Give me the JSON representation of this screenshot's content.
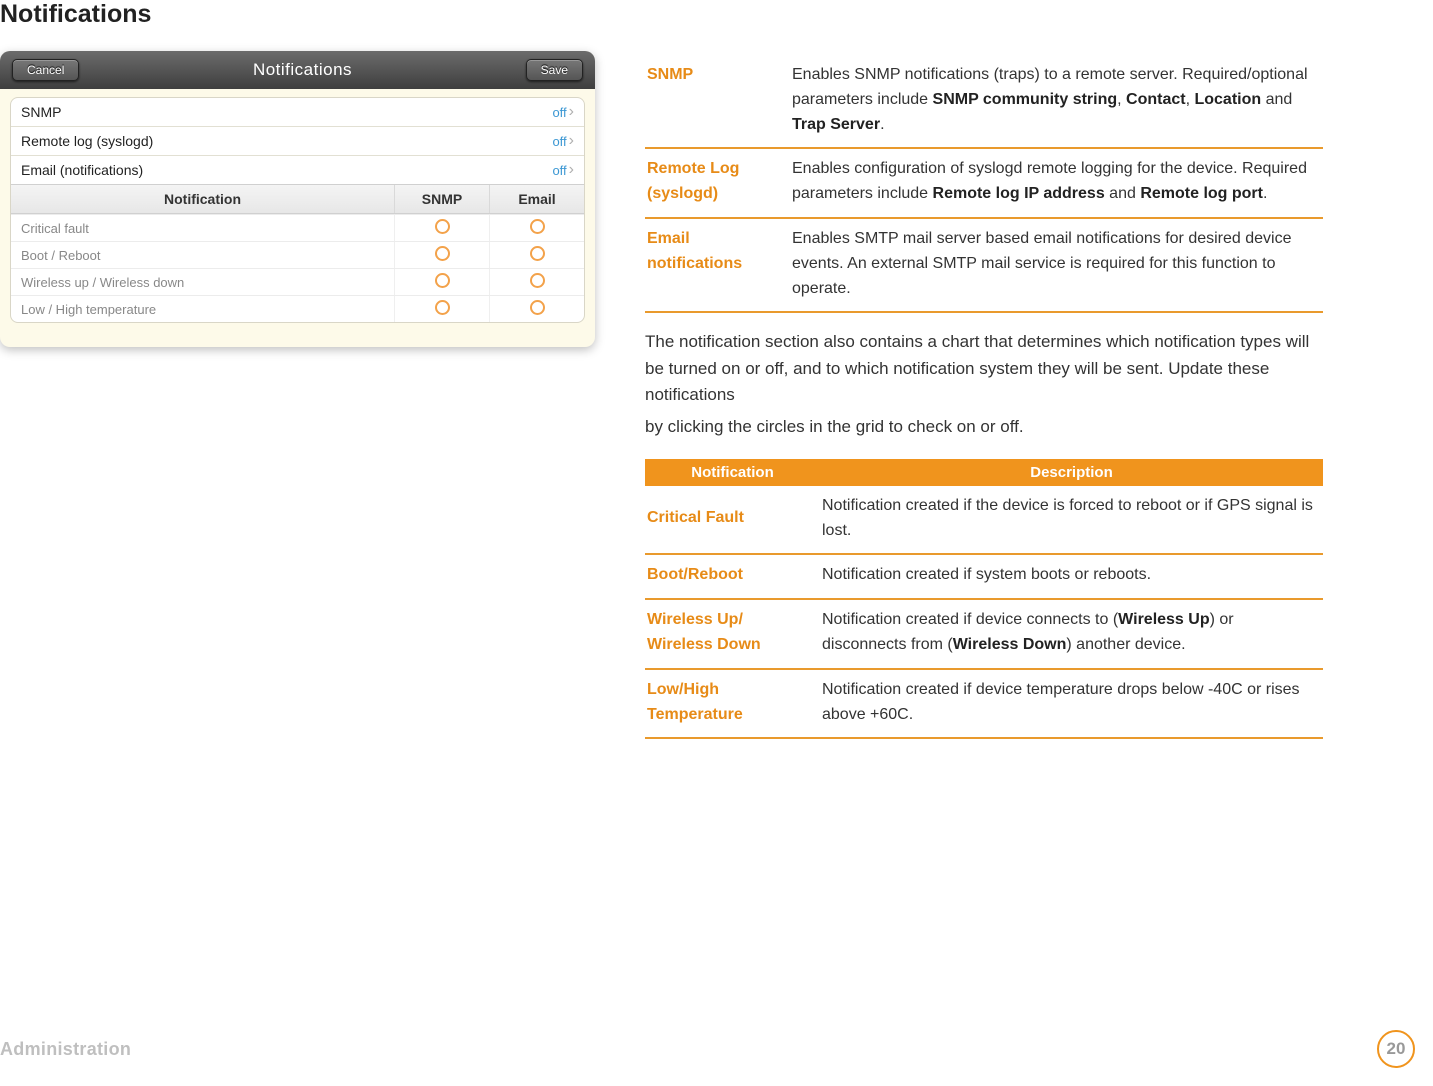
{
  "heading": "Notifications",
  "screenshot": {
    "cancel": "Cancel",
    "save": "Save",
    "title": "Notifications",
    "rows": [
      {
        "label": "SNMP",
        "state": "off"
      },
      {
        "label": "Remote log (syslogd)",
        "state": "off"
      },
      {
        "label": "Email (notifications)",
        "state": "off"
      }
    ],
    "grid_headers": {
      "notif": "Notification",
      "snmp": "SNMP",
      "email": "Email"
    },
    "grid_rows": [
      "Critical fault",
      "Boot / Reboot",
      "Wireless up / Wireless down",
      "Low / High temperature"
    ]
  },
  "defs": [
    {
      "key": "SNMP",
      "pre": "Enables SNMP notifications (traps) to a remote server. Required/optional parameters include ",
      "b1": "SNMP community string",
      "s1": ", ",
      "b2": "Contact",
      "s2": ", ",
      "b3": "Location",
      "s3": " and ",
      "b4": "Trap Server",
      "post": "."
    },
    {
      "key": "Remote Log (syslogd)",
      "pre": "Enables configuration of syslogd remote logging for the device. Required parameters include ",
      "b1": "Remote log IP address",
      "s1": " and ",
      "b2": "Remote log port",
      "post": "."
    },
    {
      "key": "Email notifications",
      "pre": "Enables SMTP mail server based email notifications for desired device events. An external SMTP mail service is required for this function to operate.",
      "post": ""
    }
  ],
  "para1": "The notification section also contains a chart that determines which notification types will be turned on or off, and to which notification system they will be sent. Update these notifications",
  "para2": "by clicking the circles in the grid to check on or off.",
  "desc_header": {
    "notif": "Notification",
    "desc": "Description"
  },
  "descs": [
    {
      "key": "Critical Fault",
      "pre": "Notification created if the device is forced to reboot or if GPS signal is lost."
    },
    {
      "key": "Boot/Reboot",
      "pre": "Notification created if system boots or reboots."
    },
    {
      "key": "Wireless Up/ Wireless Down",
      "pre": "Notification created if device connects to (",
      "b1": "Wireless Up",
      "s1": ") or disconnects from (",
      "b2": "Wireless Down",
      "post": ") another device."
    },
    {
      "key": "Low/High Temperature",
      "pre": "Notification created if device temperature drops below -40C or rises above +60C."
    }
  ],
  "footer": {
    "label": "Administration",
    "page": "20"
  }
}
